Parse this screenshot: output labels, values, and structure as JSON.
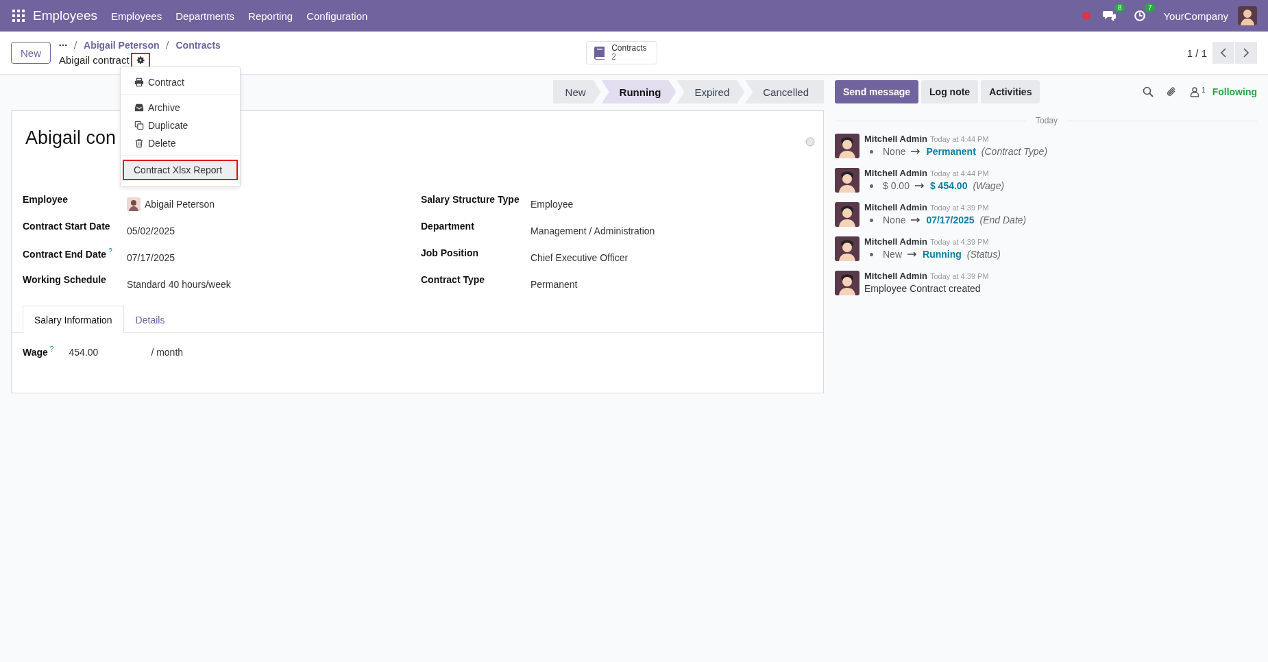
{
  "navbar": {
    "app_name": "Employees",
    "menu": [
      "Employees",
      "Departments",
      "Reporting",
      "Configuration"
    ],
    "messages_badge": "8",
    "activities_badge": "7",
    "company": "YourCompany"
  },
  "control_panel": {
    "new_button": "New",
    "breadcrumbs": [
      "Abigail Peterson",
      "Contracts"
    ],
    "record_name": "Abigail contract",
    "gear_highlighted": true,
    "smart_button": {
      "label": "Contracts",
      "count": "2"
    },
    "pager": "1 / 1"
  },
  "action_menu": {
    "groups": [
      {
        "items": [
          {
            "label": "Contract",
            "highlighted": false
          }
        ]
      },
      {
        "items": [
          {
            "label": "Archive",
            "highlighted": false
          },
          {
            "label": "Duplicate",
            "highlighted": false
          },
          {
            "label": "Delete",
            "highlighted": false
          }
        ]
      },
      {
        "items": [
          {
            "label": "Contract Xlsx Report",
            "highlighted": true
          }
        ]
      }
    ]
  },
  "statusbar": [
    {
      "label": "New",
      "selected": false
    },
    {
      "label": "Running",
      "selected": true
    },
    {
      "label": "Expired",
      "selected": false
    },
    {
      "label": "Cancelled",
      "selected": false
    }
  ],
  "form": {
    "title": "Abigail con",
    "left_fields": [
      {
        "kind": "employee",
        "label": "Employee",
        "value": "Abigail Peterson"
      },
      {
        "kind": "text",
        "label": "Contract Start Date",
        "value": "05/02/2025"
      },
      {
        "kind": "text",
        "label": "Contract End Date",
        "help": "?",
        "value": "07/17/2025"
      },
      {
        "kind": "text",
        "label": "Working Schedule",
        "value": "Standard 40 hours/week"
      }
    ],
    "right_fields": [
      {
        "kind": "text",
        "label": "Salary Structure Type",
        "value": "Employee"
      },
      {
        "kind": "text",
        "label": "Department",
        "value": "Management / Administration"
      },
      {
        "kind": "text",
        "label": "Job Position",
        "value": "Chief Executive Officer"
      },
      {
        "kind": "text",
        "label": "Contract Type",
        "value": "Permanent"
      }
    ],
    "tabs": [
      {
        "label": "Salary Information",
        "selected": true
      },
      {
        "label": "Details",
        "selected": false
      }
    ],
    "wage": {
      "label": "Wage",
      "help": "?",
      "value": "454.00",
      "unit": "/ month"
    }
  },
  "chatter": {
    "buttons": [
      {
        "label": "Send message",
        "primary": true
      },
      {
        "label": "Log note",
        "primary": false
      },
      {
        "label": "Activities",
        "primary": false
      }
    ],
    "follower_count": "1",
    "following": "Following",
    "date_divider": "Today",
    "messages": [
      {
        "kind": "tracking",
        "author": "Mitchell Admin",
        "time": "Today at 4:44 PM",
        "old": "None",
        "new": "Permanent",
        "field": "(Contract Type)"
      },
      {
        "kind": "tracking",
        "author": "Mitchell Admin",
        "time": "Today at 4:44 PM",
        "old": "$ 0.00",
        "new": "$ 454.00",
        "field": "(Wage)"
      },
      {
        "kind": "tracking",
        "author": "Mitchell Admin",
        "time": "Today at 4:39 PM",
        "old": "None",
        "new": "07/17/2025",
        "field": "(End Date)"
      },
      {
        "kind": "tracking",
        "author": "Mitchell Admin",
        "time": "Today at 4:39 PM",
        "old": "New",
        "new": "Running",
        "field": "(Status)"
      },
      {
        "kind": "note",
        "author": "Mitchell Admin",
        "time": "Today at 4:39 PM",
        "body": "Employee Contract created"
      }
    ]
  }
}
